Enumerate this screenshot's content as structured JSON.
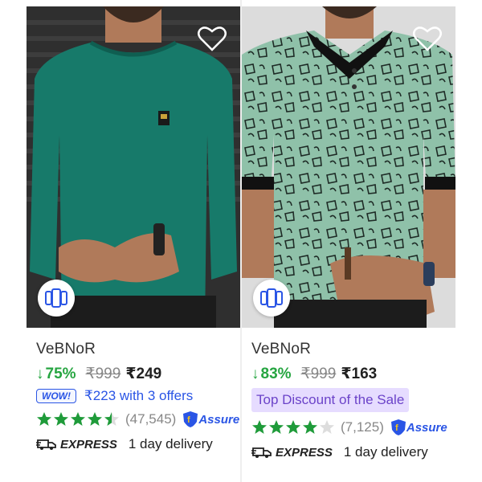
{
  "products": [
    {
      "brand": "VeBNoR",
      "discount": "75%",
      "mrp": "₹999",
      "price": "₹249",
      "offer_badge": "WOW!",
      "offer_text": "₹223 with 3 offers",
      "rating_stars": 4.5,
      "rating_count": "(47,545)",
      "assured_label": "Assure",
      "express_label": "EXPRESS",
      "delivery_text": "1 day delivery",
      "shirt_color": "#177a6a"
    },
    {
      "brand": "VeBNoR",
      "discount": "83%",
      "mrp": "₹999",
      "price": "₹163",
      "tag_text": "Top Discount of the Sale",
      "rating_stars": 4,
      "rating_count": "(7,125)",
      "assured_label": "Assure",
      "express_label": "EXPRESS",
      "delivery_text": "1 day delivery",
      "shirt_color": "#8fc1a9"
    }
  ],
  "colors": {
    "discount_green": "#26a541",
    "rating_green": "#1f9b3a",
    "link_blue": "#2a55e5",
    "tag_bg": "#e6dcff",
    "tag_text": "#6b43c9"
  },
  "icons": [
    "heart-outline-icon",
    "similar-products-icon",
    "star-icon",
    "arrow-down-icon",
    "assured-badge-icon",
    "express-truck-icon"
  ]
}
